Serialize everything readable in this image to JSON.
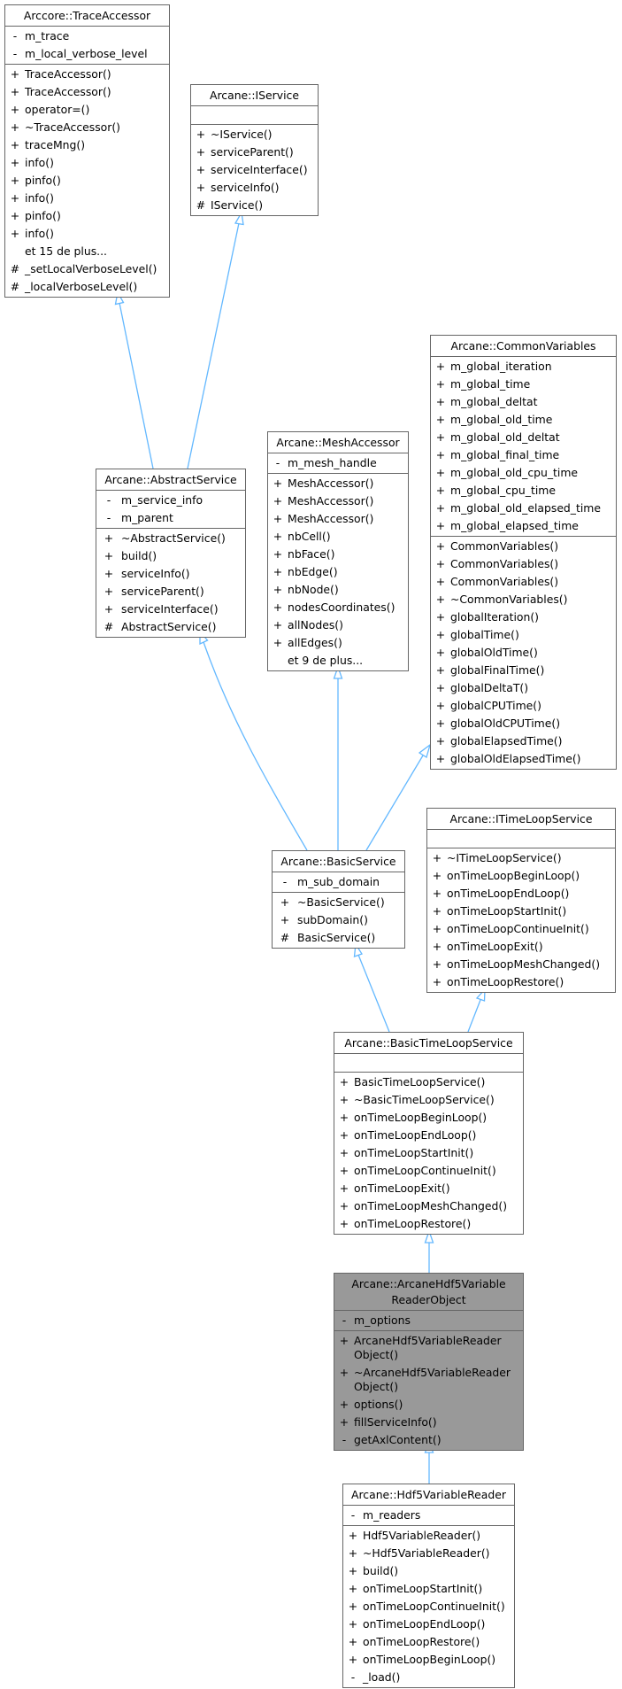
{
  "diagram": {
    "type": "class-inheritance",
    "edge_color": "#63b8ff",
    "highlight_fill": "#999999",
    "classes": {
      "trace_accessor": {
        "name": "Arccore::TraceAccessor",
        "attributes": [
          {
            "vis": "-",
            "name": "m_trace"
          },
          {
            "vis": "-",
            "name": "m_local_verbose_level"
          }
        ],
        "methods": [
          {
            "vis": "+",
            "name": "TraceAccessor()"
          },
          {
            "vis": "+",
            "name": "TraceAccessor()"
          },
          {
            "vis": "+",
            "name": "operator=()"
          },
          {
            "vis": "+",
            "name": "~TraceAccessor()"
          },
          {
            "vis": "+",
            "name": "traceMng()"
          },
          {
            "vis": "+",
            "name": "info()"
          },
          {
            "vis": "+",
            "name": "pinfo()"
          },
          {
            "vis": "+",
            "name": "info()"
          },
          {
            "vis": "+",
            "name": "pinfo()"
          },
          {
            "vis": "+",
            "name": "info()"
          },
          {
            "vis": "",
            "name": "et 15 de plus..."
          },
          {
            "vis": "#",
            "name": "_setLocalVerboseLevel()"
          },
          {
            "vis": "#",
            "name": "_localVerboseLevel()"
          }
        ]
      },
      "iservice": {
        "name": "Arcane::IService",
        "attributes": [],
        "methods": [
          {
            "vis": "+",
            "name": "~IService()"
          },
          {
            "vis": "+",
            "name": "serviceParent()"
          },
          {
            "vis": "+",
            "name": "serviceInterface()"
          },
          {
            "vis": "+",
            "name": "serviceInfo()"
          },
          {
            "vis": "#",
            "name": "IService()"
          }
        ]
      },
      "abstract_service": {
        "name": "Arcane::AbstractService",
        "attributes": [
          {
            "vis": "-",
            "name": "m_service_info"
          },
          {
            "vis": "-",
            "name": "m_parent"
          }
        ],
        "methods": [
          {
            "vis": "+",
            "name": "~AbstractService()"
          },
          {
            "vis": "+",
            "name": "build()"
          },
          {
            "vis": "+",
            "name": "serviceInfo()"
          },
          {
            "vis": "+",
            "name": "serviceParent()"
          },
          {
            "vis": "+",
            "name": "serviceInterface()"
          },
          {
            "vis": "#",
            "name": "AbstractService()"
          }
        ]
      },
      "mesh_accessor": {
        "name": "Arcane::MeshAccessor",
        "attributes": [
          {
            "vis": "-",
            "name": "m_mesh_handle"
          }
        ],
        "methods": [
          {
            "vis": "+",
            "name": "MeshAccessor()"
          },
          {
            "vis": "+",
            "name": "MeshAccessor()"
          },
          {
            "vis": "+",
            "name": "MeshAccessor()"
          },
          {
            "vis": "+",
            "name": "nbCell()"
          },
          {
            "vis": "+",
            "name": "nbFace()"
          },
          {
            "vis": "+",
            "name": "nbEdge()"
          },
          {
            "vis": "+",
            "name": "nbNode()"
          },
          {
            "vis": "+",
            "name": "nodesCoordinates()"
          },
          {
            "vis": "+",
            "name": "allNodes()"
          },
          {
            "vis": "+",
            "name": "allEdges()"
          },
          {
            "vis": "",
            "name": "et 9 de plus..."
          }
        ]
      },
      "common_variables": {
        "name": "Arcane::CommonVariables",
        "attributes": [
          {
            "vis": "+",
            "name": "m_global_iteration"
          },
          {
            "vis": "+",
            "name": "m_global_time"
          },
          {
            "vis": "+",
            "name": "m_global_deltat"
          },
          {
            "vis": "+",
            "name": "m_global_old_time"
          },
          {
            "vis": "+",
            "name": "m_global_old_deltat"
          },
          {
            "vis": "+",
            "name": "m_global_final_time"
          },
          {
            "vis": "+",
            "name": "m_global_old_cpu_time"
          },
          {
            "vis": "+",
            "name": "m_global_cpu_time"
          },
          {
            "vis": "+",
            "name": "m_global_old_elapsed_time"
          },
          {
            "vis": "+",
            "name": "m_global_elapsed_time"
          }
        ],
        "methods": [
          {
            "vis": "+",
            "name": "CommonVariables()"
          },
          {
            "vis": "+",
            "name": "CommonVariables()"
          },
          {
            "vis": "+",
            "name": "CommonVariables()"
          },
          {
            "vis": "+",
            "name": "~CommonVariables()"
          },
          {
            "vis": "+",
            "name": "globalIteration()"
          },
          {
            "vis": "+",
            "name": "globalTime()"
          },
          {
            "vis": "+",
            "name": "globalOldTime()"
          },
          {
            "vis": "+",
            "name": "globalFinalTime()"
          },
          {
            "vis": "+",
            "name": "globalDeltaT()"
          },
          {
            "vis": "+",
            "name": "globalCPUTime()"
          },
          {
            "vis": "+",
            "name": "globalOldCPUTime()"
          },
          {
            "vis": "+",
            "name": "globalElapsedTime()"
          },
          {
            "vis": "+",
            "name": "globalOldElapsedTime()"
          }
        ]
      },
      "basic_service": {
        "name": "Arcane::BasicService",
        "attributes": [
          {
            "vis": "-",
            "name": "m_sub_domain"
          }
        ],
        "methods": [
          {
            "vis": "+",
            "name": "~BasicService()"
          },
          {
            "vis": "+",
            "name": "subDomain()"
          },
          {
            "vis": "#",
            "name": "BasicService()"
          }
        ]
      },
      "itimeloop_service": {
        "name": "Arcane::ITimeLoopService",
        "attributes": [],
        "methods": [
          {
            "vis": "+",
            "name": "~ITimeLoopService()"
          },
          {
            "vis": "+",
            "name": "onTimeLoopBeginLoop()"
          },
          {
            "vis": "+",
            "name": "onTimeLoopEndLoop()"
          },
          {
            "vis": "+",
            "name": "onTimeLoopStartInit()"
          },
          {
            "vis": "+",
            "name": "onTimeLoopContinueInit()"
          },
          {
            "vis": "+",
            "name": "onTimeLoopExit()"
          },
          {
            "vis": "+",
            "name": "onTimeLoopMeshChanged()"
          },
          {
            "vis": "+",
            "name": "onTimeLoopRestore()"
          }
        ]
      },
      "basic_timeloop_service": {
        "name": "Arcane::BasicTimeLoopService",
        "attributes": [],
        "methods": [
          {
            "vis": "+",
            "name": "BasicTimeLoopService()"
          },
          {
            "vis": "+",
            "name": "~BasicTimeLoopService()"
          },
          {
            "vis": "+",
            "name": "onTimeLoopBeginLoop()"
          },
          {
            "vis": "+",
            "name": "onTimeLoopEndLoop()"
          },
          {
            "vis": "+",
            "name": "onTimeLoopStartInit()"
          },
          {
            "vis": "+",
            "name": "onTimeLoopContinueInit()"
          },
          {
            "vis": "+",
            "name": "onTimeLoopExit()"
          },
          {
            "vis": "+",
            "name": "onTimeLoopMeshChanged()"
          },
          {
            "vis": "+",
            "name": "onTimeLoopRestore()"
          }
        ]
      },
      "hdf5_reader_object": {
        "name": "Arcane::ArcaneHdf5Variable\nReaderObject",
        "attributes": [
          {
            "vis": "-",
            "name": "m_options"
          }
        ],
        "methods": [
          {
            "vis": "+",
            "name": "ArcaneHdf5VariableReader\nObject()"
          },
          {
            "vis": "+",
            "name": "~ArcaneHdf5VariableReader\nObject()"
          },
          {
            "vis": "+",
            "name": "options()"
          },
          {
            "vis": "+",
            "name": "fillServiceInfo()"
          },
          {
            "vis": "-",
            "name": "getAxlContent()"
          }
        ]
      },
      "hdf5_variable_reader": {
        "name": "Arcane::Hdf5VariableReader",
        "attributes": [
          {
            "vis": "-",
            "name": "m_readers"
          }
        ],
        "methods": [
          {
            "vis": "+",
            "name": "Hdf5VariableReader()"
          },
          {
            "vis": "+",
            "name": "~Hdf5VariableReader()"
          },
          {
            "vis": "+",
            "name": "build()"
          },
          {
            "vis": "+",
            "name": "onTimeLoopStartInit()"
          },
          {
            "vis": "+",
            "name": "onTimeLoopContinueInit()"
          },
          {
            "vis": "+",
            "name": "onTimeLoopEndLoop()"
          },
          {
            "vis": "+",
            "name": "onTimeLoopRestore()"
          },
          {
            "vis": "+",
            "name": "onTimeLoopBeginLoop()"
          },
          {
            "vis": "-",
            "name": "_load()"
          }
        ]
      }
    },
    "edges": [
      {
        "from": "abstract_service",
        "to": "trace_accessor"
      },
      {
        "from": "abstract_service",
        "to": "iservice"
      },
      {
        "from": "basic_service",
        "to": "abstract_service"
      },
      {
        "from": "basic_service",
        "to": "mesh_accessor"
      },
      {
        "from": "basic_service",
        "to": "common_variables"
      },
      {
        "from": "basic_timeloop_service",
        "to": "basic_service"
      },
      {
        "from": "basic_timeloop_service",
        "to": "itimeloop_service"
      },
      {
        "from": "hdf5_reader_object",
        "to": "basic_timeloop_service"
      },
      {
        "from": "hdf5_variable_reader",
        "to": "hdf5_reader_object"
      }
    ]
  }
}
